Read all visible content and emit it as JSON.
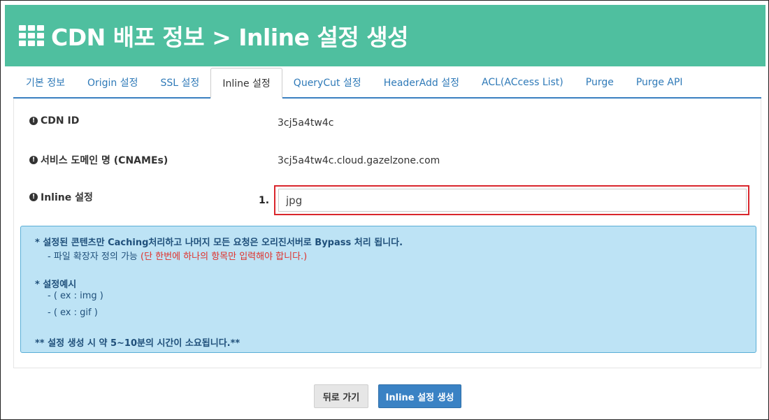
{
  "header": {
    "title": "CDN 배포 정보 > Inline 설정 생성",
    "icon": "grid-icon",
    "bg_color": "#4fbf9f"
  },
  "tabs": [
    {
      "label": "기본 정보"
    },
    {
      "label": "Origin 설정"
    },
    {
      "label": "SSL 설정"
    },
    {
      "label": "Inline 설정",
      "active": true
    },
    {
      "label": "QueryCut 설정"
    },
    {
      "label": "HeaderAdd 설정"
    },
    {
      "label": "ACL(ACcess List)"
    },
    {
      "label": "Purge"
    },
    {
      "label": "Purge API"
    }
  ],
  "fields": {
    "cdn_id": {
      "label": "CDN ID",
      "value": "3cj5a4tw4c"
    },
    "service_domain": {
      "label": "서비스 도메인 명 (CNAMEs)",
      "value": "3cj5a4tw4c.cloud.gazelzone.com"
    },
    "inline": {
      "label": "Inline 설정",
      "value": "jpg",
      "step": "1."
    }
  },
  "notice": {
    "line1": "* 설정된 콘텐츠만 Caching처리하고 나머지 모든 요청은 오리진서버로 Bypass 처리 됩니다.",
    "line2_prefix": "- 파일 확장자 정의 가능 ",
    "line2_warning": "(단 한번에 하나의 항목만 입력해야 합니다.)",
    "example_title": "* 설정예시",
    "example1": "- ( ex : img )",
    "example2": "- ( ex : gif )",
    "footer": "** 설정 생성 시 약 5~10분의 시간이 소요됩니다.**"
  },
  "buttons": {
    "back": "뒤로 가기",
    "create": "Inline 설정 생성"
  }
}
